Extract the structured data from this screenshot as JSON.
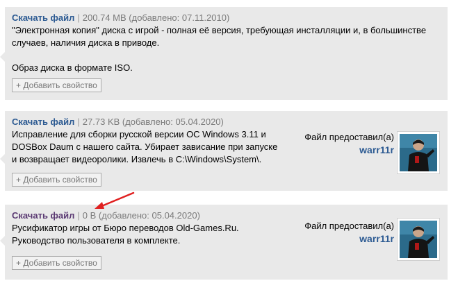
{
  "files": [
    {
      "download_label": "Скачать файл",
      "separator": "|",
      "meta": "200.74 MB (добавлено: 07.11.2010)",
      "desc_lines": [
        "\"Электронная копия\" диска с игрой - полная её версия, требующая инсталляции и, в большинстве",
        "случаев, наличия диска в приводе."
      ],
      "desc_extra": "Образ диска в формате ISO.",
      "add_property": "+ Добавить свойство"
    },
    {
      "download_label": "Скачать файл",
      "separator": "|",
      "meta": "27.73 KB (добавлено: 05.04.2020)",
      "desc_lines": [
        "Исправление для сборки русской версии ОС Windows 3.11 и",
        "DOSBox Daum с нашего сайта. Убирает зависание при запуске",
        "и возвращает видеоролики. Извлечь в C:\\Windows\\System\\."
      ],
      "uploader_label": "Файл предоставил(а)",
      "uploader_name": "warr11r",
      "add_property": "+ Добавить свойство"
    },
    {
      "download_label": "Скачать файл",
      "separator": "|",
      "meta": "0 B (добавлено: 05.04.2020)",
      "desc_lines": [
        "Русификатор игры от Бюро переводов Old-Games.Ru.",
        "Руководство пользователя в комплекте."
      ],
      "uploader_label": "Файл предоставил(а)",
      "uploader_name": "warr11r",
      "add_property": "+ Добавить свойство"
    }
  ],
  "colors": {
    "panel_bg": "#e9e9e9",
    "link": "#2c5a92",
    "link_visited": "#5b3a73",
    "annotation_arrow": "#e02020"
  },
  "icons": {
    "avatar": "user-avatar-image",
    "annotation": "red-arrow-annotation"
  }
}
